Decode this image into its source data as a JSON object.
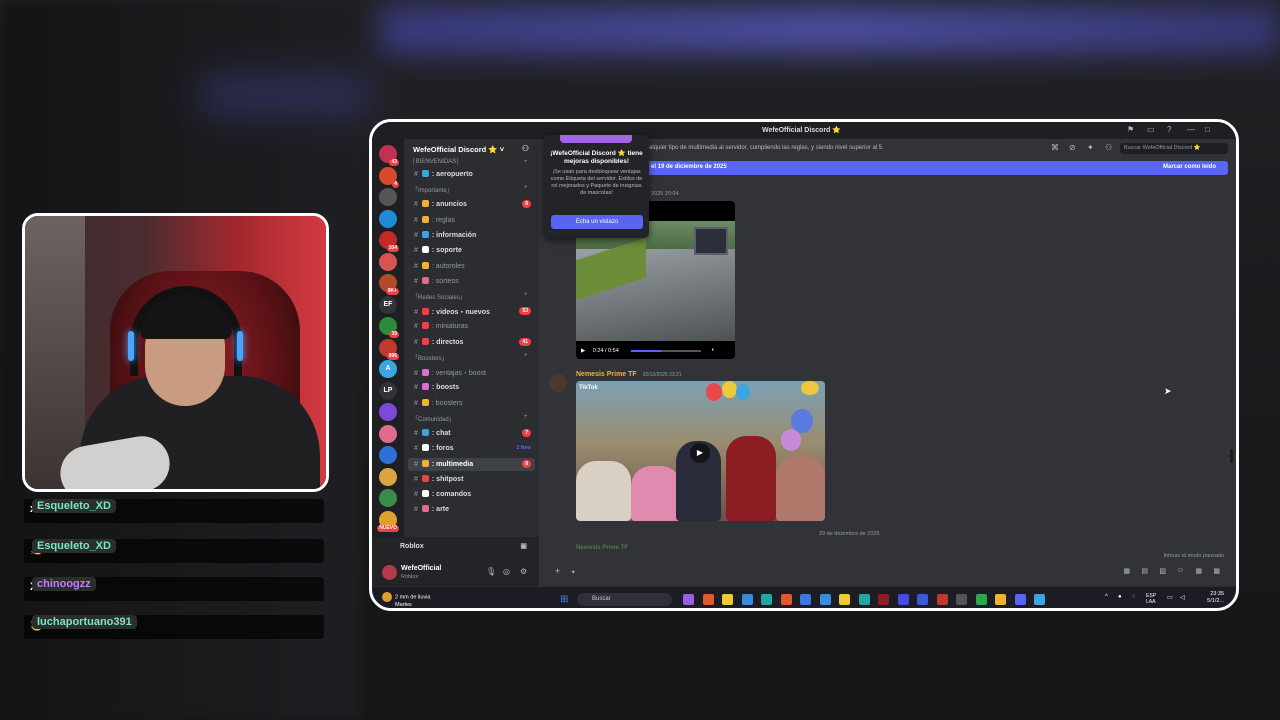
{
  "stream": {
    "chat": [
      {
        "user": "Esqueleto_XD",
        "user_color": "#7fe3c8",
        "text": "xD"
      },
      {
        "user": "Esqueleto_XD",
        "user_color": "#7fe3c8",
        "text": "👏"
      },
      {
        "user": "chinoogzz",
        "user_color": "#c77dff",
        "text": "XDDDDD"
      },
      {
        "user": "luchaportuano391",
        "user_color": "#7fe3c8",
        "text": "😺"
      }
    ]
  },
  "discord": {
    "window_title": "WefeOfficial Discord ⭐",
    "server_name": "WefeOfficial Discord ⭐",
    "servers": [
      {
        "label": "",
        "badge": "43",
        "color": "#c03050"
      },
      {
        "label": "",
        "badge": "4",
        "color": "#d94a2a"
      },
      {
        "label": "",
        "badge": "",
        "color": "#555"
      },
      {
        "label": "",
        "badge": "",
        "color": "#1f8ad8"
      },
      {
        "label": "",
        "badge": "104",
        "color": "#c62828"
      },
      {
        "label": "",
        "badge": "",
        "color": "#d9534f"
      },
      {
        "label": "",
        "badge": "9K+",
        "color": "#b34a2a"
      },
      {
        "label": "EF",
        "badge": "",
        "color": "#313338"
      },
      {
        "label": "",
        "badge": "39",
        "color": "#2e8b3a"
      },
      {
        "label": "",
        "badge": "996",
        "color": "#c0392b"
      },
      {
        "label": "A",
        "badge": "",
        "color": "#3aa5e0"
      },
      {
        "label": "LP",
        "badge": "",
        "color": "#313338"
      },
      {
        "label": "",
        "badge": "",
        "color": "#7b4bd8"
      },
      {
        "label": "",
        "badge": "",
        "color": "#e06b8a"
      },
      {
        "label": "",
        "badge": "",
        "color": "#2e6fd6"
      },
      {
        "label": "",
        "badge": "",
        "color": "#d9a441"
      },
      {
        "label": "",
        "badge": "",
        "color": "#3a8a4a"
      },
      {
        "label": "",
        "badge": "NUEVO",
        "color": "#e0a030"
      }
    ],
    "top_category": "│BIENVENIDAS│",
    "categories": [
      {
        "name": "「Importante」",
        "channels": [
          {
            "name": "anuncios",
            "bold": true,
            "badge": "8",
            "emoji_color": "#f0b232"
          },
          {
            "name": "reglas",
            "bold": false,
            "badge": "",
            "emoji_color": "#f0b232"
          },
          {
            "name": "información",
            "bold": true,
            "badge": "",
            "emoji_color": "#3aa5e0"
          },
          {
            "name": "soporte",
            "bold": true,
            "badge": "",
            "emoji_color": "#ffffff"
          },
          {
            "name": "autoroles",
            "bold": false,
            "badge": "",
            "emoji_color": "#f0b232"
          },
          {
            "name": "sorteos",
            "bold": false,
            "badge": "",
            "emoji_color": "#e06b8a"
          }
        ]
      },
      {
        "name": "「Redes Sociales」",
        "channels": [
          {
            "name": "videos・nuevos",
            "bold": true,
            "badge": "53",
            "emoji_color": "#f23f43"
          },
          {
            "name": "miniaturas",
            "bold": false,
            "badge": "",
            "emoji_color": "#f23f43"
          },
          {
            "name": "directos",
            "bold": true,
            "badge": "41",
            "emoji_color": "#f23f43"
          }
        ]
      },
      {
        "name": "「Boosters」",
        "channels": [
          {
            "name": "ventajas・boost",
            "bold": false,
            "badge": "",
            "emoji_color": "#e06bd8"
          },
          {
            "name": "boosts",
            "bold": true,
            "badge": "",
            "emoji_color": "#e06bd8"
          },
          {
            "name": "boosters",
            "bold": false,
            "badge": "",
            "emoji_color": "#f0b232"
          }
        ]
      },
      {
        "name": "「Comunidad」",
        "channels": [
          {
            "name": "chat",
            "bold": true,
            "badge": "7",
            "emoji_color": "#3aa5e0"
          },
          {
            "name": "foros",
            "bold": true,
            "badge": "",
            "new": "2 New",
            "emoji_color": "#ffffff"
          },
          {
            "name": "multimedia",
            "bold": true,
            "badge": "8",
            "emoji_color": "#f0b232",
            "active": true
          },
          {
            "name": "shitpost",
            "bold": true,
            "badge": "",
            "emoji_color": "#f23f43"
          },
          {
            "name": "comandos",
            "bold": true,
            "badge": "",
            "emoji_color": "#ffffff"
          },
          {
            "name": "arte",
            "bold": true,
            "badge": "",
            "emoji_color": "#e06b8a"
          }
        ]
      }
    ],
    "first_channel": {
      "name": "aeropuerto"
    },
    "voice": {
      "label": "Roblox"
    },
    "user": {
      "name": "WefeOfficial",
      "status": "Roblox"
    },
    "topic": "alquier tipo de multimedia al servidor, cumpliendo las reglas, y siendo nivel superior al 5.",
    "search_placeholder": "Buscar WefeOfficial Discord ⭐",
    "new_messages_bar": {
      "text": "el 19 de diciembre de 2025",
      "action": "Marcar como leído"
    },
    "popup": {
      "title": "¡WefeOfficial Discord ⭐ tiene mejoras disponibles!",
      "body": "¡Se usan para desbloquear ventajas como Etiqueta del servidor. Estilos de rol mejorados y Paquete de insignias de mascotas!",
      "button": "Echa un vistazo"
    },
    "messages": [
      {
        "timestamp": "2025 20:04",
        "video_time": "0:24 / 0:54",
        "progress": 0.43
      },
      {
        "author": "Nemesis Prime TF",
        "timestamp": "22/12/2025 23:21",
        "watermark": "TikTok"
      }
    ],
    "date_divider": "29 de diciembre de 2025",
    "ghost_author": "Nemesis Prime TF",
    "paused_notice": "Intruso al modo pausado",
    "composer_icon": "+"
  },
  "taskbar": {
    "weather_temp": "2 mm de lluvia",
    "weather_day": "Martes",
    "search": "Buscar",
    "lang_top": "ESP",
    "lang_bottom": "LAA",
    "time": "23:35",
    "date": "5/1/2..."
  }
}
